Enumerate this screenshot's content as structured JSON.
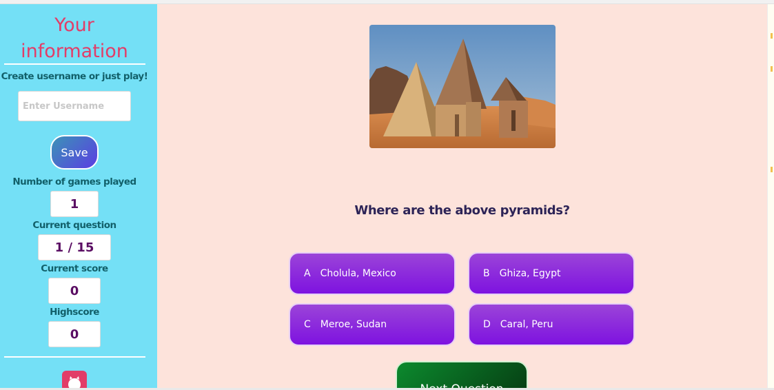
{
  "sidebar": {
    "title_line1": "Your",
    "title_line2": "information",
    "create_label": "Create username or just play!",
    "username_placeholder": "Enter Username",
    "username_value": "",
    "save_label": "Save",
    "games_played_label": "Number of games played",
    "games_played_value": "1",
    "current_question_label": "Current question",
    "current_question_value": "1 / 15",
    "current_score_label": "Current score",
    "current_score_value": "0",
    "highscore_label": "Highscore",
    "highscore_value": "0",
    "github_icon": "github-icon"
  },
  "main": {
    "question": "Where are the above pyramids?",
    "answers": [
      {
        "letter": "A",
        "text": "Cholula, Mexico"
      },
      {
        "letter": "B",
        "text": "Ghiza, Egypt"
      },
      {
        "letter": "C",
        "text": "Meroe, Sudan"
      },
      {
        "letter": "D",
        "text": "Caral, Peru"
      }
    ],
    "next_label": "Next Question"
  },
  "colors": {
    "sidebar_bg": "#74e0f6",
    "main_bg": "#fde3db",
    "title_color": "#e23d68",
    "answer_purple": "#8a20e0",
    "next_green": "#0c8a2e"
  }
}
